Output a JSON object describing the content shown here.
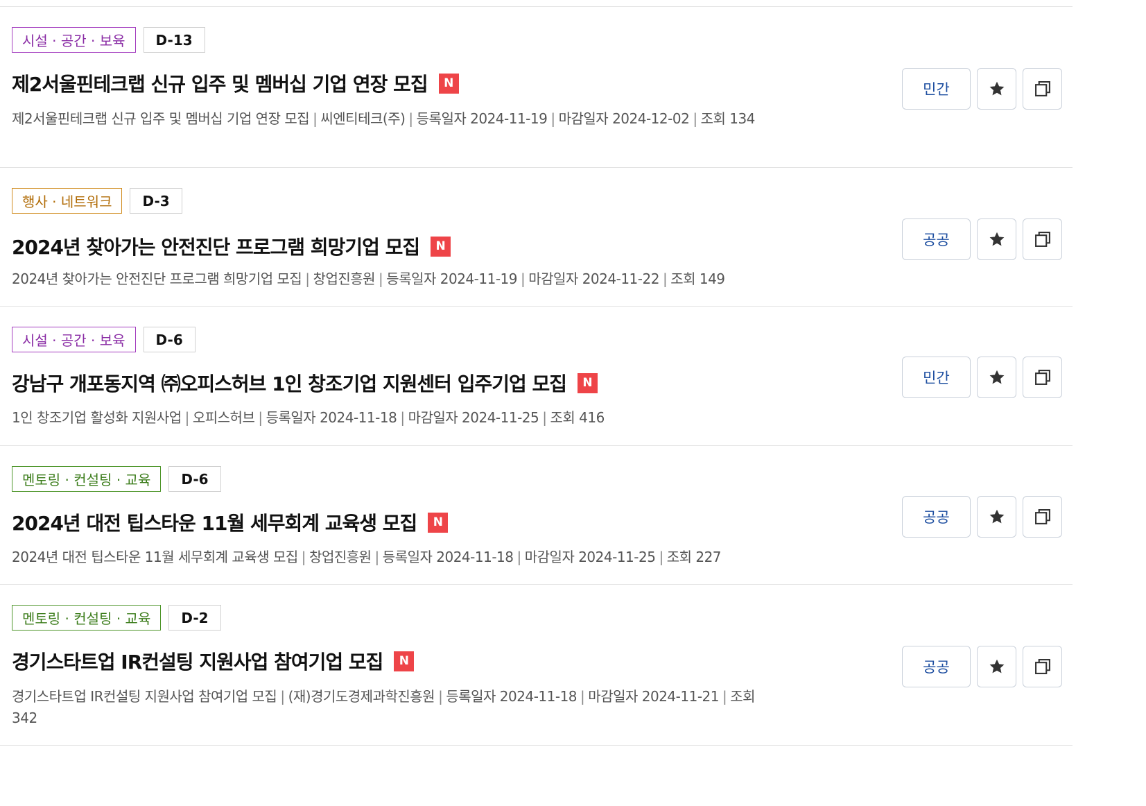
{
  "items": [
    {
      "category": "시설 · 공간 · 보육",
      "dday": "D-13",
      "title": "제2서울핀테크랩 신규 입주 및 멤버십 기업 연장 모집",
      "new_badge": "N",
      "summary": "제2서울핀테크랩 신규 입주 및 멤버십 기업 연장 모집",
      "org": "씨엔티테크(주)",
      "reg": "등록일자 2024-11-19",
      "deadline": "마감일자 2024-12-02",
      "views": "조회 134",
      "type": "민간"
    },
    {
      "category": "행사 · 네트워크",
      "dday": "D-3",
      "title": "2024년 찾아가는 안전진단 프로그램 희망기업 모집",
      "new_badge": "N",
      "summary": "2024년 찾아가는 안전진단 프로그램 희망기업 모집",
      "org": "창업진흥원",
      "reg": "등록일자 2024-11-19",
      "deadline": "마감일자 2024-11-22",
      "views": "조회 149",
      "type": "공공"
    },
    {
      "category": "시설 · 공간 · 보육",
      "dday": "D-6",
      "title": "강남구 개포동지역 ㈜오피스허브 1인 창조기업 지원센터 입주기업 모집",
      "new_badge": "N",
      "summary": "1인 창조기업 활성화 지원사업",
      "org": "오피스허브",
      "reg": "등록일자 2024-11-18",
      "deadline": "마감일자 2024-11-25",
      "views": "조회 416",
      "type": "민간"
    },
    {
      "category": "멘토링 · 컨설팅 · 교육",
      "dday": "D-6",
      "title": "2024년 대전 팁스타운 11월 세무회계 교육생 모집",
      "new_badge": "N",
      "summary": "2024년 대전 팁스타운 11월 세무회계 교육생 모집",
      "org": "창업진흥원",
      "reg": "등록일자 2024-11-18",
      "deadline": "마감일자 2024-11-25",
      "views": "조회 227",
      "type": "공공"
    },
    {
      "category": "멘토링 · 컨설팅 · 교육",
      "dday": "D-2",
      "title": "경기스타트업 IR컨설팅 지원사업 참여기업 모집",
      "new_badge": "N",
      "summary": "경기스타트업 IR컨설팅 지원사업 참여기업 모집",
      "org": "(재)경기도경제과학진흥원",
      "reg": "등록일자 2024-11-18",
      "deadline": "마감일자 2024-11-21",
      "views": "조회 342",
      "type": "공공"
    }
  ],
  "colors": {
    "facility_tag": "#a33bbf",
    "event_tag": "#d08b1d",
    "mentor_tag": "#4c9428",
    "new_badge": "#ee4448",
    "type_button_text": "#1d4ea0"
  },
  "icons": {
    "favorite": "star-icon",
    "copy": "copy-icon"
  }
}
